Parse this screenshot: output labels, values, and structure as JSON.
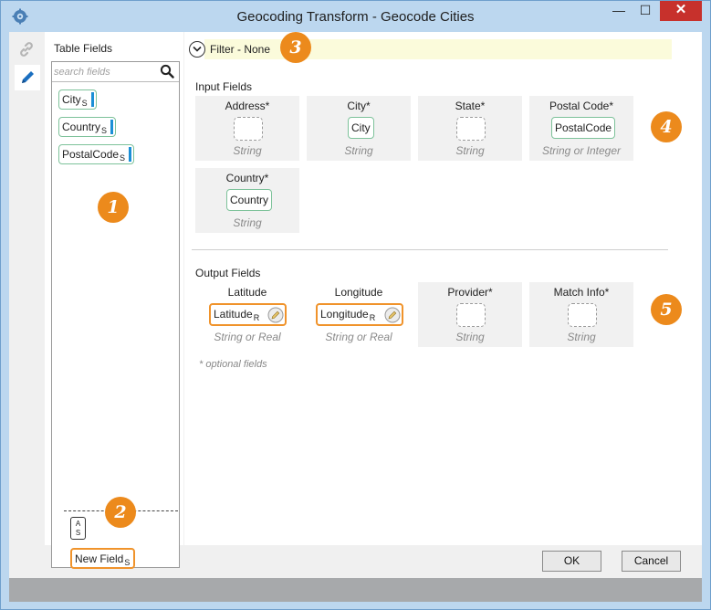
{
  "window": {
    "title": "Geocoding Transform - Geocode Cities",
    "minimize": "—",
    "maximize": "☐",
    "close": "✕"
  },
  "left_panel": {
    "title": "Table Fields",
    "search_placeholder": "search fields",
    "fields": [
      {
        "name": "City",
        "type": "S"
      },
      {
        "name": "Country",
        "type": "S"
      },
      {
        "name": "PostalCode",
        "type": "S"
      }
    ],
    "toggle_top": "A",
    "toggle_bottom": "S",
    "new_field": {
      "name": "New Field",
      "type": "S"
    }
  },
  "filter": {
    "label": "Filter - None"
  },
  "input_section": {
    "label": "Input Fields",
    "cards": [
      {
        "label": "Address*",
        "chip": "",
        "type": "String"
      },
      {
        "label": "City*",
        "chip": "City",
        "type": "String"
      },
      {
        "label": "State*",
        "chip": "",
        "type": "String"
      },
      {
        "label": "Postal Code*",
        "chip": "PostalCode",
        "type": "String or Integer"
      },
      {
        "label": "Country*",
        "chip": "Country",
        "type": "String"
      }
    ]
  },
  "output_section": {
    "label": "Output Fields",
    "cards": [
      {
        "label": "Latitude",
        "chip": "Latitude",
        "sub": "R",
        "type": "String or Real"
      },
      {
        "label": "Longitude",
        "chip": "Longitude",
        "sub": "R",
        "type": "String or Real"
      },
      {
        "label": "Provider*",
        "chip": "",
        "type": "String"
      },
      {
        "label": "Match Info*",
        "chip": "",
        "type": "String"
      }
    ],
    "footnote": "* optional fields"
  },
  "badges": [
    "1",
    "2",
    "3",
    "4",
    "5"
  ],
  "buttons": {
    "ok": "OK",
    "cancel": "Cancel"
  },
  "colors": {
    "accent_orange": "#ec8a1c",
    "input_chip_border": "#7dc29a",
    "output_chip_border": "#f0932b",
    "field_bar": "#1b8fd6",
    "filter_bg": "#fbfbdb"
  }
}
